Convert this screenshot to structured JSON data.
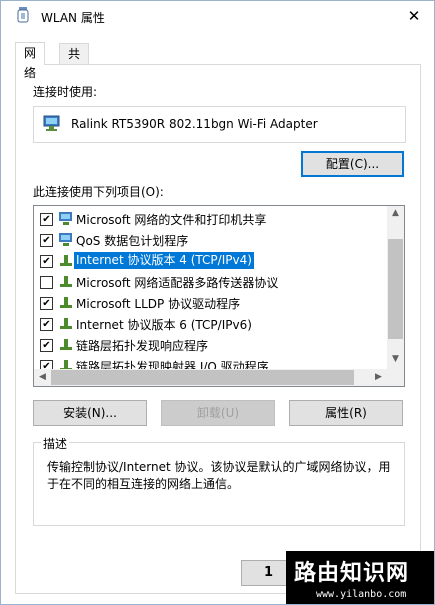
{
  "window": {
    "title": "WLAN 属性",
    "close_glyph": "✕"
  },
  "tabs": [
    {
      "label": "网络",
      "active": true
    },
    {
      "label": "共享",
      "active": false
    }
  ],
  "connect_using": {
    "label": "连接时使用:",
    "adapter": "Ralink RT5390R 802.11bgn Wi-Fi Adapter",
    "configure_button": "配置(C)..."
  },
  "items_section": {
    "label": "此连接使用下列项目(O):",
    "items": [
      {
        "label": "Microsoft 网络的文件和打印机共享",
        "checked": true,
        "icon": "network-client-icon",
        "selected": false
      },
      {
        "label": "QoS 数据包计划程序",
        "checked": true,
        "icon": "network-client-icon",
        "selected": false
      },
      {
        "label": "Internet 协议版本 4 (TCP/IPv4)",
        "checked": true,
        "icon": "protocol-icon",
        "selected": true
      },
      {
        "label": "Microsoft 网络适配器多路传送器协议",
        "checked": false,
        "icon": "protocol-icon",
        "selected": false
      },
      {
        "label": "Microsoft LLDP 协议驱动程序",
        "checked": true,
        "icon": "protocol-icon",
        "selected": false
      },
      {
        "label": "Internet 协议版本 6 (TCP/IPv6)",
        "checked": true,
        "icon": "protocol-icon",
        "selected": false
      },
      {
        "label": "链路层拓扑发现响应程序",
        "checked": true,
        "icon": "protocol-icon",
        "selected": false
      },
      {
        "label": "链路层拓扑发现映射器 I/O 驱动程序",
        "checked": true,
        "icon": "protocol-icon",
        "selected": false
      }
    ]
  },
  "buttons": {
    "install": "安装(N)...",
    "uninstall": "卸载(U)",
    "properties": "属性(R)"
  },
  "description": {
    "title": "描述",
    "text": "传输控制协议/Internet 协议。该协议是默认的广域网络协议，用于在不同的相互连接的网络上通信。"
  },
  "watermark": {
    "text": "路由知识网",
    "url": "www.yilanbo.com"
  },
  "ok_partial": "1",
  "colors": {
    "selection": "#0078d7",
    "focus_border": "#0078d7"
  }
}
